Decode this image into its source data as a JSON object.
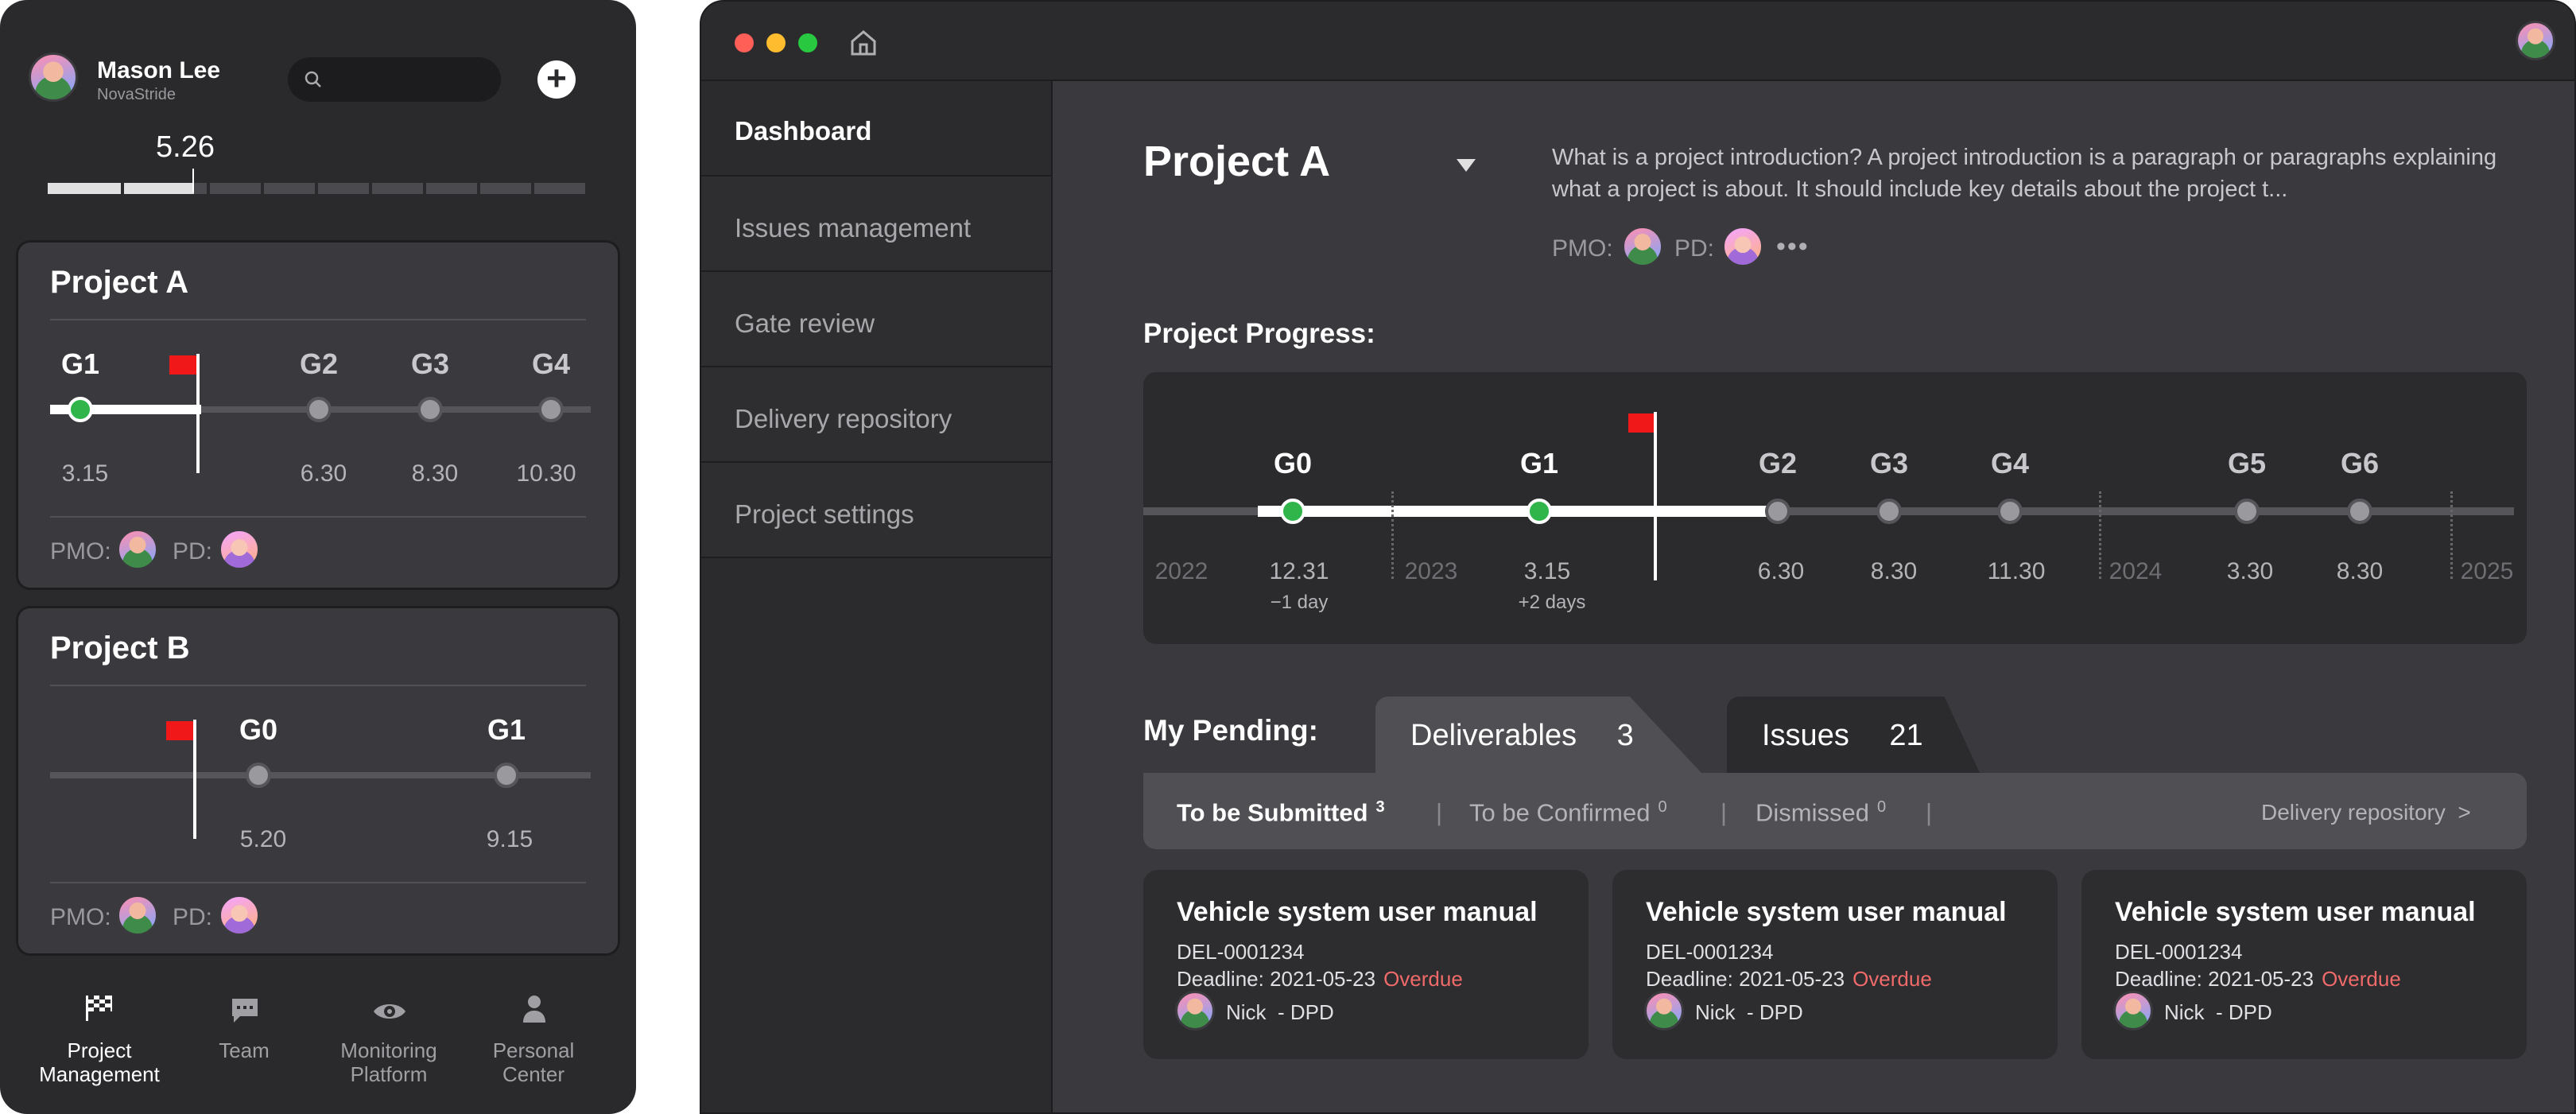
{
  "mobile": {
    "user": {
      "name": "Mason Lee",
      "org": "NovaStride"
    },
    "date_value": "5.26",
    "projects": [
      {
        "title": "Project A",
        "gates": [
          "G1",
          "G2",
          "G3",
          "G4"
        ],
        "dates": [
          "3.15",
          "6.30",
          "8.30",
          "10.30"
        ],
        "pmo_label": "PMO:",
        "pd_label": "PD:"
      },
      {
        "title": "Project B",
        "gates": [
          "G0",
          "G1"
        ],
        "dates": [
          "5.20",
          "9.15"
        ],
        "pmo_label": "PMO:",
        "pd_label": "PD:"
      }
    ],
    "nav": [
      {
        "label": "Project Management",
        "icon": "checkered-flag-icon"
      },
      {
        "label": "Team",
        "icon": "chat-icon"
      },
      {
        "label": "Monitoring Platform",
        "icon": "eye-icon"
      },
      {
        "label": "Personal Center",
        "icon": "person-icon"
      }
    ]
  },
  "desktop": {
    "sidebar": [
      "Dashboard",
      "Issues management",
      "Gate review",
      "Delivery repository",
      "Project settings"
    ],
    "project_title": "Project A",
    "intro": "What is a project introduction? A project introduction is a paragraph or paragraphs explaining what a project is about. It should include key details about the project t...",
    "pmo_label": "PMO:",
    "pd_label": "PD:",
    "progress_title": "Project Progress:",
    "timeline": {
      "gates": [
        "G0",
        "G1",
        "G2",
        "G3",
        "G4",
        "G5",
        "G6"
      ],
      "dates": [
        "12.31",
        "3.15",
        "6.30",
        "8.30",
        "11.30",
        "3.30",
        "8.30"
      ],
      "offsets": [
        "−1 day",
        "+2 days"
      ],
      "years": [
        "2022",
        "2023",
        "2024",
        "2025"
      ]
    },
    "pending": {
      "title": "My Pending:",
      "tabs": [
        {
          "label": "Deliverables",
          "count": "3"
        },
        {
          "label": "Issues",
          "count": "21"
        }
      ],
      "subtabs": [
        {
          "label": "To be Submitted",
          "count": "3"
        },
        {
          "label": "To be Confirmed",
          "count": "0"
        },
        {
          "label": "Dismissed",
          "count": "0"
        }
      ],
      "link": "Delivery repository  >",
      "cards": [
        {
          "title": "Vehicle system user manual",
          "id": "DEL-0001234",
          "deadline": "Deadline: 2021-05-23",
          "status": "Overdue",
          "owner": "Nick  - DPD"
        },
        {
          "title": "Vehicle system user manual",
          "id": "DEL-0001234",
          "deadline": "Deadline: 2021-05-23",
          "status": "Overdue",
          "owner": "Nick  - DPD"
        },
        {
          "title": "Vehicle system user manual",
          "id": "DEL-0001234",
          "deadline": "Deadline: 2021-05-23",
          "status": "Overdue",
          "owner": "Nick  - DPD"
        }
      ]
    }
  }
}
